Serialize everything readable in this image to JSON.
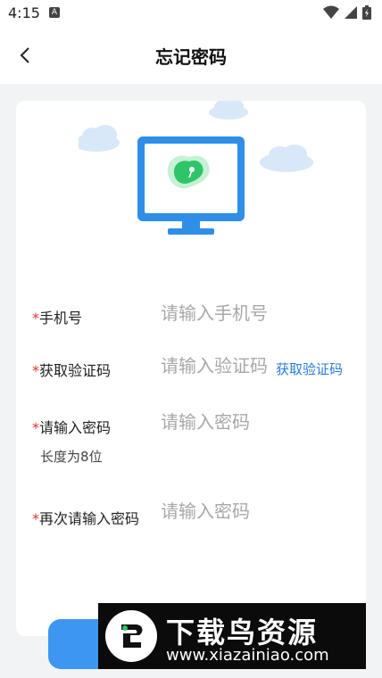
{
  "status": {
    "time": "4:15",
    "sim_label": "A"
  },
  "appbar": {
    "title": "忘记密码"
  },
  "form": {
    "phone": {
      "required": "*",
      "label": "手机号",
      "placeholder": "请输入手机号"
    },
    "code": {
      "required": "*",
      "label": "获取验证码",
      "placeholder": "请输入验证码",
      "get_code": "获取验证码"
    },
    "password": {
      "required": "*",
      "label": "请输入密码",
      "placeholder": "请输入密码",
      "hint": "长度为8位"
    },
    "confirm": {
      "required": "*",
      "label": "再次请输入密码",
      "placeholder": "请输入密码"
    }
  },
  "submit": {
    "label": ""
  },
  "watermark": {
    "title": "下载鸟资源",
    "url": "www.xiazainiao.com"
  },
  "colors": {
    "accent": "#3d97f2",
    "required": "#e0322c",
    "link": "#2a7bd7"
  },
  "icons": [
    "back-arrow-icon",
    "wifi-icon",
    "signal-icon",
    "battery-icon",
    "monitor-icon",
    "cloud-icon",
    "location-pin-icon"
  ]
}
